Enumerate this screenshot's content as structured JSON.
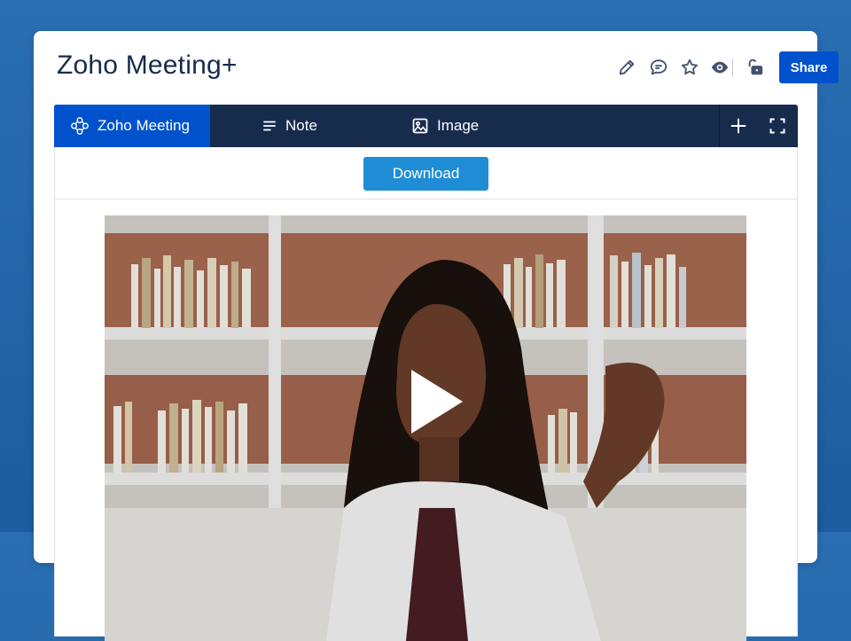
{
  "page": {
    "title": "Zoho Meeting+"
  },
  "toolbar": {
    "icons": [
      "pencil-icon",
      "comment-icon",
      "star-icon",
      "eye-icon",
      "unlock-icon",
      "more-icon"
    ],
    "share_label": "Share"
  },
  "macro": {
    "tabs": [
      {
        "label": "Zoho Meeting",
        "icon": "zoho-meeting-icon",
        "active": true
      },
      {
        "label": "Note",
        "icon": "lines-icon",
        "active": false
      },
      {
        "label": "Image",
        "icon": "image-icon",
        "active": false
      }
    ],
    "actions": [
      "plus-icon",
      "fullscreen-icon"
    ],
    "download_label": "Download"
  },
  "colors": {
    "background": "#2a6fb3",
    "primary": "#0052cc",
    "tabbar": "#172b4d",
    "download": "#1f8dd6",
    "title": "#172b4d"
  }
}
